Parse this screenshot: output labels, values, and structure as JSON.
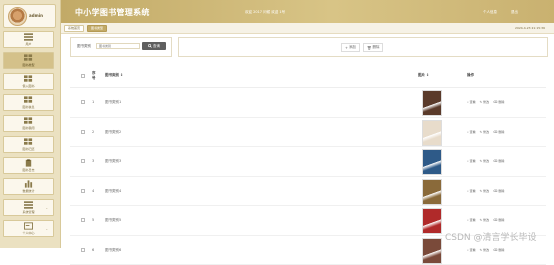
{
  "app": {
    "title": "中小学图书管理系统"
  },
  "header": {
    "info": "欢迎 2017 问候 欢迎 1号",
    "link_profile": "个人信息",
    "link_logout": "退出"
  },
  "user": {
    "name": "admin"
  },
  "sidebar": {
    "items": [
      {
        "label": "用户",
        "icon": "list-icon"
      },
      {
        "label": "图书类型",
        "icon": "grid-icon"
      },
      {
        "label": "借入图书",
        "icon": "grid-icon"
      },
      {
        "label": "图书信息",
        "icon": "grid-icon"
      },
      {
        "label": "图书借阅",
        "icon": "grid-icon"
      },
      {
        "label": "图书归还",
        "icon": "grid-icon"
      },
      {
        "label": "图书日志",
        "icon": "clipboard-icon"
      },
      {
        "label": "数据统计",
        "icon": "bar-chart-icon"
      },
      {
        "label": "系统管理",
        "icon": "list-icon"
      },
      {
        "label": "个人中心",
        "icon": "card-icon"
      }
    ]
  },
  "breadcrumb": {
    "home": "系统首页",
    "current": "图书类型"
  },
  "datetime": "2024-4-23 21:15:36",
  "search": {
    "label": "图书类别",
    "placeholder": "图书类别",
    "button": "查询"
  },
  "toolbar": {
    "add": "添加",
    "delete": "删除"
  },
  "table": {
    "headers": {
      "index": "序号",
      "name": "图书类别",
      "image": "图片",
      "ops": "操作"
    },
    "rows": [
      {
        "index": "1",
        "name": "图书类别1",
        "cover": "#5a3a2a"
      },
      {
        "index": "2",
        "name": "图书类别2",
        "cover": "#e8dccb"
      },
      {
        "index": "3",
        "name": "图书类别3",
        "cover": "#2e5a88"
      },
      {
        "index": "4",
        "name": "图书类别4",
        "cover": "#8a6a3a"
      },
      {
        "index": "5",
        "name": "图书类别5",
        "cover": "#b02a2a"
      },
      {
        "index": "6",
        "name": "图书类别6",
        "cover": "#7a4a3a"
      }
    ],
    "ops": {
      "view": "查看",
      "edit": "修改",
      "delete": "删除"
    }
  },
  "watermark": "CSDN @清言学长毕设"
}
